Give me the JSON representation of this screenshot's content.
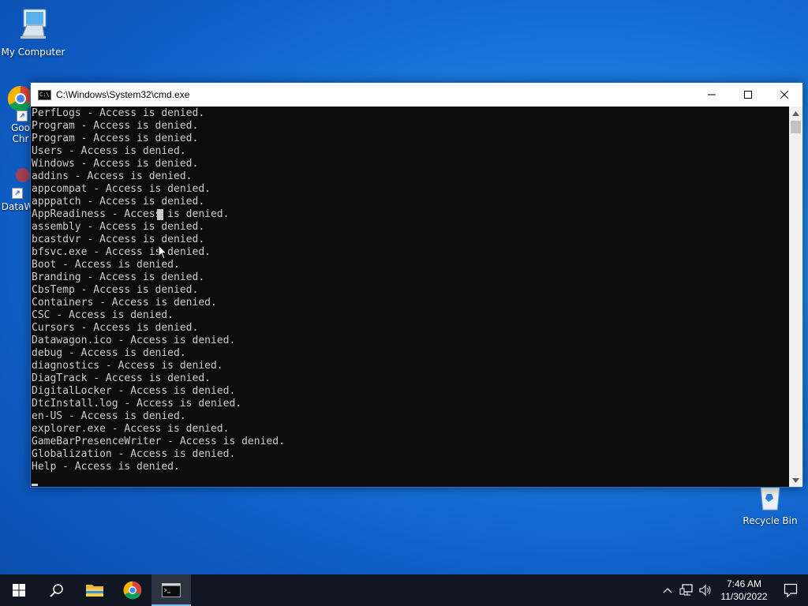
{
  "desktop": {
    "icons": [
      {
        "label": "My Computer"
      },
      {
        "label": "Google Chrome",
        "visible_label": "Goo Chr"
      },
      {
        "label": "DataW"
      },
      {
        "label": "Recycle Bin"
      }
    ]
  },
  "cmd_window": {
    "title": "C:\\Windows\\System32\\cmd.exe",
    "lines": [
      "PerfLogs - Access is denied.",
      "Program - Access is denied.",
      "Program - Access is denied.",
      "Users - Access is denied.",
      "Windows - Access is denied.",
      "addins - Access is denied.",
      "appcompat - Access is denied.",
      "apppatch - Access is denied.",
      "AppReadiness - Access is denied.",
      "assembly - Access is denied.",
      "bcastdvr - Access is denied.",
      "bfsvc.exe - Access is denied.",
      "Boot - Access is denied.",
      "Branding - Access is denied.",
      "CbsTemp - Access is denied.",
      "Containers - Access is denied.",
      "CSC - Access is denied.",
      "Cursors - Access is denied.",
      "Datawagon.ico - Access is denied.",
      "debug - Access is denied.",
      "diagnostics - Access is denied.",
      "DiagTrack - Access is denied.",
      "DigitalLocker - Access is denied.",
      "DtcInstall.log - Access is denied.",
      "en-US - Access is denied.",
      "explorer.exe - Access is denied.",
      "GameBarPresenceWriter - Access is denied.",
      "Globalization - Access is denied.",
      "Help - Access is denied."
    ]
  },
  "taskbar": {
    "clock_time": "7:46 AM",
    "clock_date": "11/30/2022"
  },
  "colors": {
    "console_bg": "#0c0c0c",
    "console_fg": "#cccccc",
    "taskbar_bg": "#101722"
  }
}
